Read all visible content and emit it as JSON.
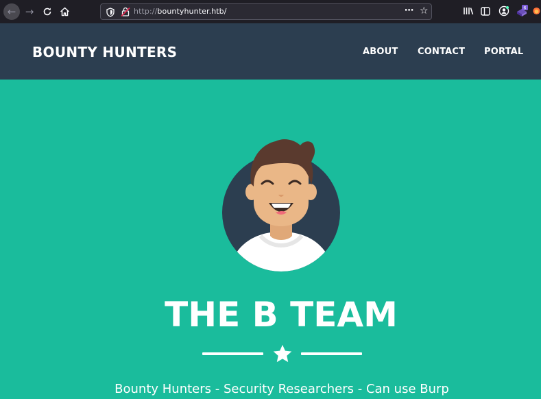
{
  "browser": {
    "url_protocol": "http://",
    "url_host": "bountyhunter.htb/",
    "icons": [
      "back-icon",
      "forward-icon",
      "reload-icon",
      "home-icon",
      "shield-icon",
      "insecure-lock-icon",
      "page-actions-icon",
      "bookmark-star-icon",
      "library-icon",
      "sidebar-icon",
      "account-icon",
      "extension-icon",
      "firefox-icon"
    ],
    "extension_badge": "6"
  },
  "header": {
    "brand": "BOUNTY HUNTERS",
    "nav": [
      {
        "label": "ABOUT"
      },
      {
        "label": "CONTACT"
      },
      {
        "label": "PORTAL"
      }
    ]
  },
  "masthead": {
    "title": "THE B TEAM",
    "subtitle": "Bounty Hunters - Security Researchers - Can use Burp"
  },
  "colors": {
    "chrome_bg": "#1f1e25",
    "header_bg": "#2c3e50",
    "masthead_bg": "#1abc9c",
    "text": "#ffffff"
  }
}
